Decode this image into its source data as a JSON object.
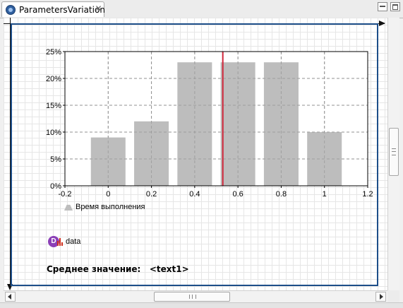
{
  "tab": {
    "title": "ParametersVariation",
    "icon": "experiment-icon",
    "close_icon": "close-icon"
  },
  "window_controls": {
    "minimize_icon": "minimize-icon",
    "maximize_icon": "maximize-icon"
  },
  "chart_data": {
    "type": "bar",
    "x": [
      0,
      0.2,
      0.4,
      0.6,
      0.8,
      1.0
    ],
    "values": [
      9,
      12,
      23,
      23,
      23,
      10
    ],
    "xlim": [
      -0.2,
      1.2
    ],
    "ylim": [
      0,
      25
    ],
    "x_ticks": [
      "-0.2",
      "0",
      "0.2",
      "0.4",
      "0.6",
      "0.8",
      "1",
      "1.2"
    ],
    "y_ticks": [
      "0%",
      "5%",
      "10%",
      "15%",
      "20%",
      "25%"
    ],
    "bar_width": 0.16,
    "mean_line_x": 0.53,
    "grid": true,
    "legend_label": "Время выполнения",
    "legend_position": "bottom-left",
    "colors": {
      "bar": "#bdbdbd",
      "mean_line": "#d0263a",
      "grid": "#9a9a9a"
    }
  },
  "data_element": {
    "label": "data",
    "icon_letter": "D",
    "icon": "dataset-icon"
  },
  "statistics": {
    "text": "Среднее значение:   <text1>"
  },
  "colors": {
    "frame": "#1d4e89",
    "canvas_grid": "#e6e6e6"
  }
}
